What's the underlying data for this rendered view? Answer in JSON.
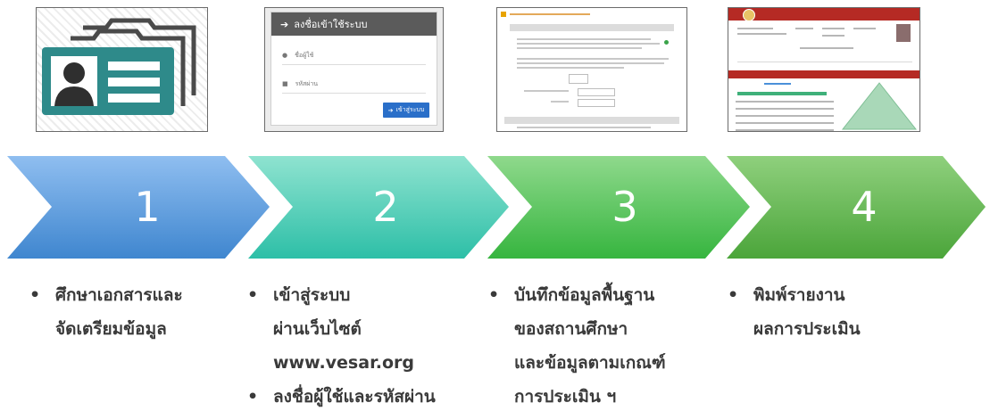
{
  "thumbnails": {
    "login": {
      "title": "ลงชื่อเข้าใช้ระบบ",
      "username_placeholder": "ชื่อผู้ใช้",
      "password_placeholder": "รหัสผ่าน",
      "submit_label": "เข้าสู่ระบบ"
    }
  },
  "steps": [
    {
      "number": "1",
      "color_start": "#8fbef0",
      "color_end": "#3f86cf"
    },
    {
      "number": "2",
      "color_start": "#8fe3d0",
      "color_end": "#2dbfa7"
    },
    {
      "number": "3",
      "color_start": "#8fd98c",
      "color_end": "#36b53f"
    },
    {
      "number": "4",
      "color_start": "#8fd07d",
      "color_end": "#4ba53a"
    }
  ],
  "bullets": {
    "step1": [
      {
        "lines": [
          "ศึกษาเอกสารและ",
          "จัดเตรียมข้อมูล"
        ]
      }
    ],
    "step2": [
      {
        "lines": [
          "เข้าสู่ระบบ",
          "ผ่านเว็บไซต์",
          "www.vesar.org"
        ]
      },
      {
        "lines": [
          "ลงชื่อผู้ใช้และรหัสผ่าน"
        ]
      }
    ],
    "step3": [
      {
        "lines": [
          "บันทึกข้อมูลพื้นฐาน",
          "ของสถานศึกษา",
          "และข้อมูลตามเกณฑ์",
          "การประเมิน ฯ"
        ]
      }
    ],
    "step4": [
      {
        "lines": [
          "พิมพ์รายงาน",
          "ผลการประเมิน"
        ]
      }
    ]
  }
}
